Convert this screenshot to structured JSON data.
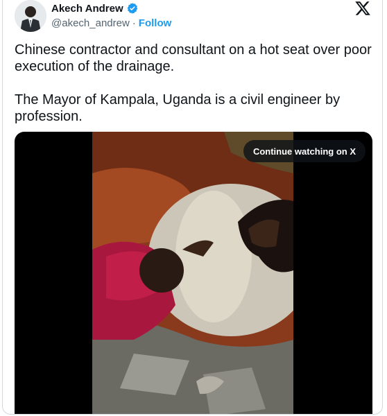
{
  "author": {
    "name": "Akech Andrew",
    "handle": "@akech_andrew",
    "separator": "·",
    "follow_label": "Follow",
    "verified_icon": "verified-badge-icon",
    "verified_color": "#1d9bf0"
  },
  "tweet": {
    "paragraphs": [
      "Chinese contractor and consultant on a hot seat over poor execution of the drainage.",
      "The Mayor of Kampala, Uganda is a civil engineer by profession."
    ]
  },
  "media": {
    "cta_label": "Continue watching on X"
  },
  "brand": {
    "logo_icon": "x-logo-icon",
    "follow_color": "#1d9bf0"
  }
}
